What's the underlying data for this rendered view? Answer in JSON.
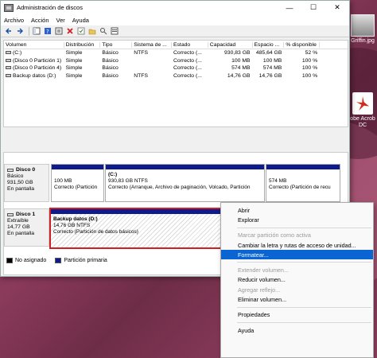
{
  "window": {
    "title": "Administración de discos",
    "controls": {
      "minimize": "—",
      "maximize": "☐",
      "close": "✕"
    }
  },
  "menu": [
    "Archivo",
    "Acción",
    "Ver",
    "Ayuda"
  ],
  "desktop": {
    "icon1_label": "Griffin.jpg",
    "icon2_label": "obe Acrob DC"
  },
  "volumes": {
    "headers": [
      "Volumen",
      "Distribución",
      "Tipo",
      "Sistema de ...",
      "Estado",
      "Capacidad",
      "Espacio ...",
      "% disponible",
      ""
    ],
    "rows": [
      [
        "(C:)",
        "Simple",
        "Básico",
        "NTFS",
        "Correcto (...",
        "930,83 GB",
        "485,64 GB",
        "52 %",
        ""
      ],
      [
        "(Disco 0 Partición 1)",
        "Simple",
        "Básico",
        "",
        "Correcto (...",
        "100 MB",
        "100 MB",
        "100 %",
        ""
      ],
      [
        "(Disco 0 Partición 4)",
        "Simple",
        "Básico",
        "",
        "Correcto (...",
        "574 MB",
        "574 MB",
        "100 %",
        ""
      ],
      [
        "Backup datos (D:)",
        "Simple",
        "Básico",
        "NTFS",
        "Correcto (...",
        "14,76 GB",
        "14,76 GB",
        "100 %",
        ""
      ]
    ]
  },
  "disks": [
    {
      "name": "Disco 0",
      "type": "Básico",
      "size": "931,50 GB",
      "status": "En pantalla",
      "partitions": [
        {
          "title": "",
          "line1": "100 MB",
          "line2": "Correcto (Partición"
        },
        {
          "title": "(C:)",
          "line1": "930,83 GB NTFS",
          "line2": "Correcto (Arranque, Archivo de paginación, Volcado, Partición"
        },
        {
          "title": "",
          "line1": "574 MB",
          "line2": "Correcto (Partición de recu"
        }
      ]
    },
    {
      "name": "Disco 1",
      "type": "Extraíble",
      "size": "14,77 GB",
      "status": "En pantalla",
      "partitions": [
        {
          "title": "Backup datos  (D:)",
          "line1": "14,76 GB NTFS",
          "line2": "Correcto (Partición de datos básicos)"
        }
      ]
    }
  ],
  "legend": [
    {
      "label": "No asignado",
      "color": "#000000"
    },
    {
      "label": "Partición primaria",
      "color": "#0d1b8c"
    }
  ],
  "context_menu": [
    {
      "label": "Abrir",
      "disabled": false
    },
    {
      "label": "Explorar",
      "disabled": false
    },
    {
      "sep": true
    },
    {
      "label": "Marcar partición como activa",
      "disabled": true
    },
    {
      "label": "Cambiar la letra y rutas de acceso de unidad...",
      "disabled": false
    },
    {
      "label": "Formatear...",
      "disabled": false,
      "highlight": true
    },
    {
      "sep": true
    },
    {
      "label": "Extender volumen...",
      "disabled": true
    },
    {
      "label": "Reducir volumen...",
      "disabled": false
    },
    {
      "label": "Agregar reflejo...",
      "disabled": true
    },
    {
      "label": "Eliminar volumen...",
      "disabled": false
    },
    {
      "sep": true
    },
    {
      "label": "Propiedades",
      "disabled": false
    },
    {
      "sep": true
    },
    {
      "label": "Ayuda",
      "disabled": false
    }
  ],
  "colors": {
    "accent": "#0a64d2",
    "primary_partition": "#0d1b8c",
    "selection_border": "#d01f26"
  }
}
